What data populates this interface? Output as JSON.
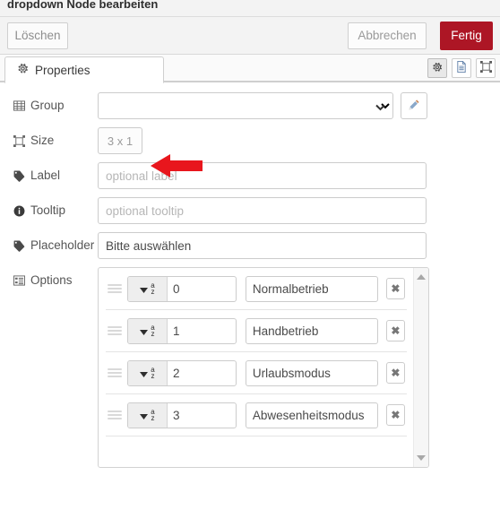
{
  "dialog": {
    "title": "dropdown Node bearbeiten",
    "delete_label": "Löschen",
    "cancel_label": "Abbrechen",
    "done_label": "Fertig",
    "accent_color": "#ad1625"
  },
  "tabs": {
    "items": [
      {
        "label": "Properties",
        "icon": "gear-icon",
        "active": true
      }
    ],
    "tool_icons": [
      {
        "name": "gear-icon",
        "active": true
      },
      {
        "name": "document-icon",
        "active": false
      },
      {
        "name": "resize-frame-icon",
        "active": false
      }
    ]
  },
  "form": {
    "group": {
      "label": "Group",
      "icon": "table-grid-icon",
      "value": "",
      "edit_button_icon": "pencil-icon",
      "caret_icon": "chevron-down-icon"
    },
    "size": {
      "label": "Size",
      "icon": "resize-frame-icon",
      "value": "3 x 1"
    },
    "label_field": {
      "label": "Label",
      "icon": "tag-icon",
      "value": "",
      "placeholder": "optional label"
    },
    "tooltip_field": {
      "label": "Tooltip",
      "icon": "info-icon",
      "value": "",
      "placeholder": "optional tooltip"
    },
    "placeholder_field": {
      "label": "Placeholder",
      "icon": "tag-icon",
      "value": "Bitte auswählen",
      "placeholder": ""
    },
    "options": {
      "label": "Options",
      "icon": "list-icon",
      "type_icon": "sort-az-icon",
      "remove_icon": "close-x-icon",
      "items": [
        {
          "value": "0",
          "text": "Normalbetrieb"
        },
        {
          "value": "1",
          "text": "Handbetrieb"
        },
        {
          "value": "2",
          "text": "Urlaubsmodus"
        },
        {
          "value": "3",
          "text": "Abwesenheitsmodus"
        }
      ]
    }
  },
  "annotation": {
    "arrow_color": "#e8161d",
    "arrow_direction": "left",
    "points_at": "size-button"
  }
}
